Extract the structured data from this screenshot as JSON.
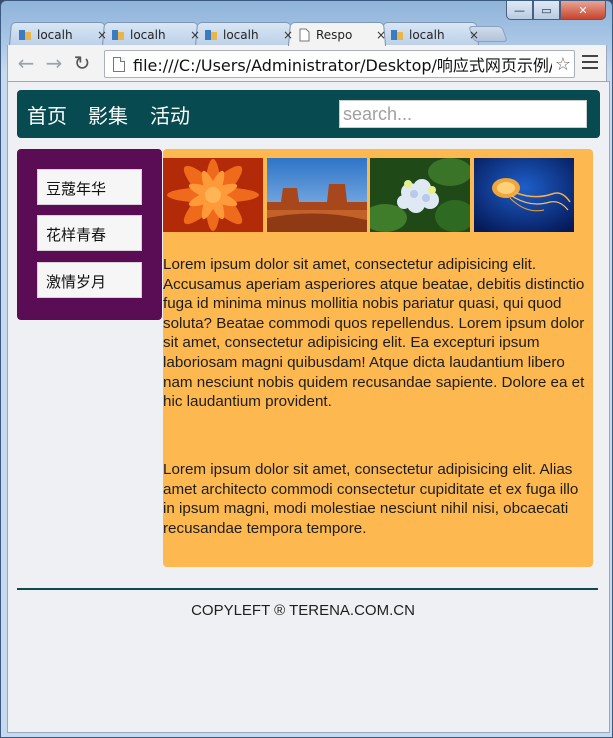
{
  "browser": {
    "tabs": [
      {
        "title": "localh",
        "active": false
      },
      {
        "title": "localh",
        "active": false
      },
      {
        "title": "localh",
        "active": false
      },
      {
        "title": "Respo",
        "active": true
      },
      {
        "title": "localh",
        "active": false
      }
    ],
    "tab_close_glyph": "×",
    "url": "file:///C:/Users/Administrator/Desktop/响应式网页示例/",
    "window_controls": {
      "minimize": "—",
      "maximize": "▭",
      "close": "✕"
    }
  },
  "site": {
    "nav": [
      "首页",
      "影集",
      "活动"
    ],
    "search_placeholder": "search...",
    "sidebar": [
      "豆蔻年华",
      "花样青春",
      "激情岁月"
    ],
    "images": [
      "flower-photo",
      "desert-photo",
      "hydrangea-photo",
      "jellyfish-photo"
    ],
    "paragraphs": [
      "Lorem ipsum dolor sit amet, consectetur adipisicing elit. Accusamus aperiam asperiores atque beatae, debitis distinctio fuga id minima minus mollitia nobis pariatur quasi, qui quod soluta? Beatae commodi quos repellendus. Lorem ipsum dolor sit amet, consectetur adipisicing elit. Ea excepturi ipsum laboriosam magni quibusdam! Atque dicta laudantium libero nam nesciunt nobis quidem recusandae sapiente. Dolore ea et hic laudantium provident.",
      "Lorem ipsum dolor sit amet, consectetur adipisicing elit. Alias amet architecto commodi consectetur cupiditate et ex fuga illo in ipsum magni, modi molestiae nesciunt nihil nisi, obcaecati recusandae tempora tempore."
    ],
    "footer": "COPYLEFT ® TERENA.COM.CN"
  },
  "colors": {
    "nav_bg": "#074a4f",
    "sidebar_bg": "#5a0c55",
    "content_bg": "#fdb94f",
    "footer_line": "#0e4a4e"
  }
}
